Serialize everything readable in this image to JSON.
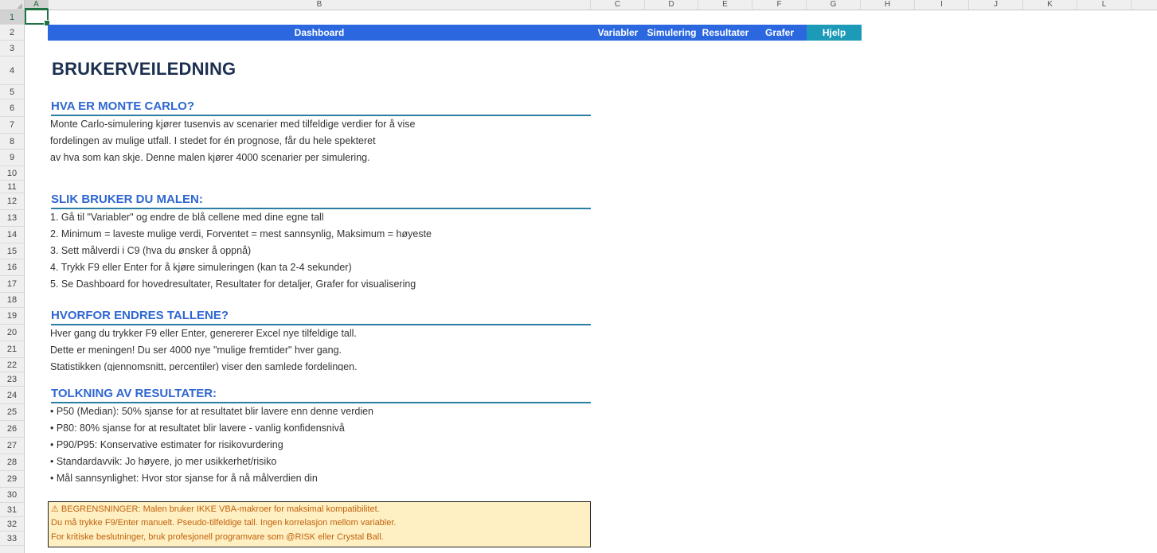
{
  "columns": [
    "A",
    "B",
    "C",
    "D",
    "E",
    "F",
    "G",
    "H",
    "I",
    "J",
    "K",
    "L"
  ],
  "rows": [
    "1",
    "2",
    "3",
    "4",
    "5",
    "6",
    "7",
    "8",
    "9",
    "10",
    "11",
    "12",
    "13",
    "14",
    "15",
    "16",
    "17",
    "18",
    "19",
    "20",
    "21",
    "22",
    "23",
    "24",
    "25",
    "26",
    "27",
    "28",
    "29",
    "30",
    "31",
    "32",
    "33"
  ],
  "nav": {
    "dashboard": "Dashboard",
    "variabler": "Variabler",
    "simulering": "Simulering",
    "resultater": "Resultater",
    "grafer": "Grafer",
    "hjelp": "Hjelp"
  },
  "title": "BRUKERVEILEDNING",
  "sections": [
    {
      "heading": "HVA ER MONTE CARLO?",
      "lines": [
        "Monte Carlo-simulering kjører tusenvis av scenarier med tilfeldige verdier for å vise",
        "fordelingen av mulige utfall. I stedet for én prognose, får du hele spekteret",
        "av hva som kan skje. Denne malen kjører 4000 scenarier per simulering."
      ]
    },
    {
      "heading": "SLIK BRUKER DU MALEN:",
      "lines": [
        "1. Gå til \"Variabler\" og endre de blå cellene med dine egne tall",
        "2. Minimum = laveste mulige verdi, Forventet = mest sannsynlig, Maksimum = høyeste",
        "3. Sett målverdi i C9 (hva du ønsker å oppnå)",
        "4. Trykk F9 eller Enter for å kjøre simuleringen (kan ta 2-4 sekunder)",
        "5. Se Dashboard for hovedresultater, Resultater for detaljer, Grafer for visualisering"
      ]
    },
    {
      "heading": "HVORFOR ENDRES TALLENE?",
      "lines": [
        "Hver gang du trykker F9 eller Enter, genererer Excel nye tilfeldige tall.",
        "Dette er meningen! Du ser 4000 nye \"mulige fremtider\" hver gang.",
        "Statistikken (gjennomsnitt, percentiler) viser den samlede fordelingen."
      ]
    },
    {
      "heading": "TOLKNING AV RESULTATER:",
      "lines": [
        "• P50 (Median): 50% sjanse for at resultatet blir lavere enn denne verdien",
        "• P80: 80% sjanse for at resultatet blir lavere - vanlig konfidensnivå",
        "• P90/P95: Konservative estimater for risikovurdering",
        "• Standardavvik: Jo høyere, jo mer usikkerhet/risiko",
        "• Mål sannsynlighet: Hvor stor sjanse for å nå målverdien din"
      ]
    }
  ],
  "warning": {
    "line1": "⚠ BEGRENSNINGER: Malen bruker IKKE VBA-makroer for maksimal kompatibilitet.",
    "line2": "Du må trykke F9/Enter manuelt. Pseudo-tilfeldige tall. Ingen korrelasjon mellom variabler.",
    "line3": "For kritiske beslutninger, bruk profesjonell programvare som @RISK eller Crystal Ball."
  }
}
